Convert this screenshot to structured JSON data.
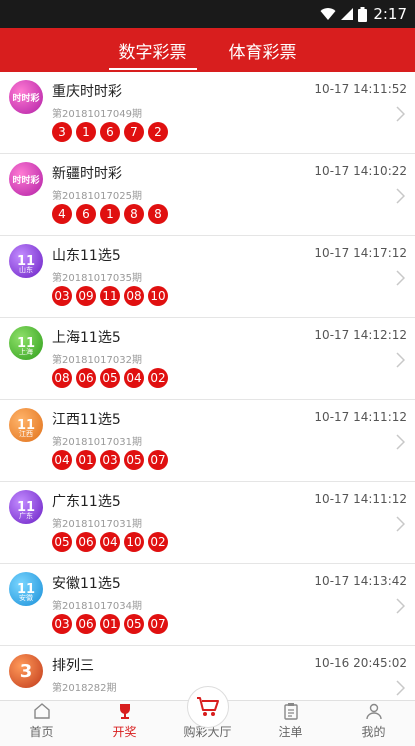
{
  "status_bar": {
    "time": "2:17"
  },
  "header": {
    "tabs": [
      {
        "label": "数字彩票"
      },
      {
        "label": "体育彩票"
      }
    ]
  },
  "colors": {
    "brand_red": "#d81e1e",
    "ball_red": "#e01010"
  },
  "lotteries": [
    {
      "name": "重庆时时彩",
      "issue": "第20181017049期",
      "time": "10-17 14:11:52",
      "numbers": [
        "3",
        "1",
        "6",
        "7",
        "2"
      ],
      "logo_text": "时时彩",
      "logo_sub": ""
    },
    {
      "name": "新疆时时彩",
      "issue": "第20181017025期",
      "time": "10-17 14:10:22",
      "numbers": [
        "4",
        "6",
        "1",
        "8",
        "8"
      ],
      "logo_text": "时时彩",
      "logo_sub": ""
    },
    {
      "name": "山东11选5",
      "issue": "第20181017035期",
      "time": "10-17 14:17:12",
      "numbers": [
        "03",
        "09",
        "11",
        "08",
        "10"
      ],
      "logo_text": "11",
      "logo_sub": "山东"
    },
    {
      "name": "上海11选5",
      "issue": "第20181017032期",
      "time": "10-17 14:12:12",
      "numbers": [
        "08",
        "06",
        "05",
        "04",
        "02"
      ],
      "logo_text": "11",
      "logo_sub": "上海"
    },
    {
      "name": "江西11选5",
      "issue": "第20181017031期",
      "time": "10-17 14:11:12",
      "numbers": [
        "04",
        "01",
        "03",
        "05",
        "07"
      ],
      "logo_text": "11",
      "logo_sub": "江西"
    },
    {
      "name": "广东11选5",
      "issue": "第20181017031期",
      "time": "10-17 14:11:12",
      "numbers": [
        "05",
        "06",
        "04",
        "10",
        "02"
      ],
      "logo_text": "11",
      "logo_sub": "广东"
    },
    {
      "name": "安徽11选5",
      "issue": "第20181017034期",
      "time": "10-17 14:13:42",
      "numbers": [
        "03",
        "06",
        "01",
        "05",
        "07"
      ],
      "logo_text": "11",
      "logo_sub": "安徽"
    },
    {
      "name": "排列三",
      "issue": "第2018282期",
      "time": "10-16 20:45:02",
      "numbers": [],
      "logo_text": "3",
      "logo_sub": ""
    }
  ],
  "tabbar": [
    {
      "label": "首页"
    },
    {
      "label": "开奖"
    },
    {
      "label": "购彩大厅"
    },
    {
      "label": "注单"
    },
    {
      "label": "我的"
    }
  ]
}
